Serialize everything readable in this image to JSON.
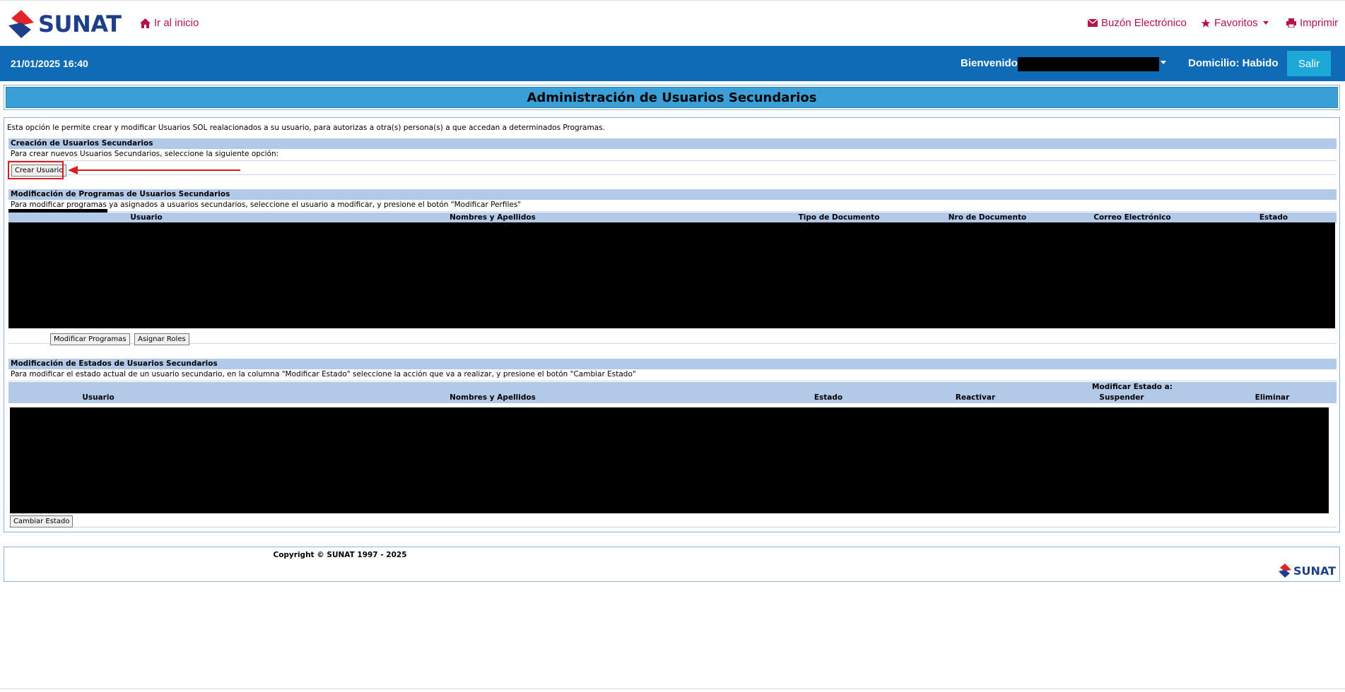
{
  "header": {
    "logo_text": "SUNAT",
    "home_link": "Ir al inicio",
    "buzon": "Buzón Electrónico",
    "favoritos": "Favoritos",
    "imprimir": "Imprimir",
    "accent_color": "#b5124b"
  },
  "bar": {
    "datetime": "21/01/2025 16:40",
    "welcome": "Bienvenido,",
    "domicilio": "Domicilio: Habido",
    "salir": "Salir",
    "bar_color": "#0f6bb5"
  },
  "page_title": "Administración de Usuarios Secundarios",
  "intro": "Esta opción le permite crear y modificar Usuarios SOL realacionados a su usuario, para autorizas a otra(s) persona(s) a que accedan a determinados Programas.",
  "creacion": {
    "heading": "Creación de Usuarios Secundarios",
    "instruction": "Para crear nuevos Usuarios Secundarios, seleccione la siguiente opción:",
    "button": "Crear Usuario"
  },
  "programas": {
    "heading": "Modificación de Programas de Usuarios Secundarios",
    "instruction": "Para modificar programas ya asignados a usuarios secundarios, seleccione el usuario a modificar, y presione el botón \"Modificar Perfiles\"",
    "columns": [
      "Usuario",
      "Nombres y Apellidos",
      "Tipo de Documento",
      "Nro de Documento",
      "Correo Electrónico",
      "Estado"
    ],
    "btn_modificar": "Modificar Programas",
    "btn_roles": "Asignar Roles"
  },
  "estados": {
    "heading": "Modificación de Estados de Usuarios Secundarios",
    "instruction": "Para modificar el estado actual de un usuario secundario, en la columna \"Modificar Estado\" seleccione la acción que va a realizar, y presione el botón \"Cambiar Estado\"",
    "group_label": "Modificar Estado a:",
    "columns": [
      "Usuario",
      "Nombres y Apellidos",
      "Estado",
      "Reactivar",
      "Suspender",
      "Eliminar"
    ],
    "button": "Cambiar Estado"
  },
  "footer": {
    "copyright": "Copyright © SUNAT 1997 - 2025",
    "logo_text": "SUNAT"
  }
}
